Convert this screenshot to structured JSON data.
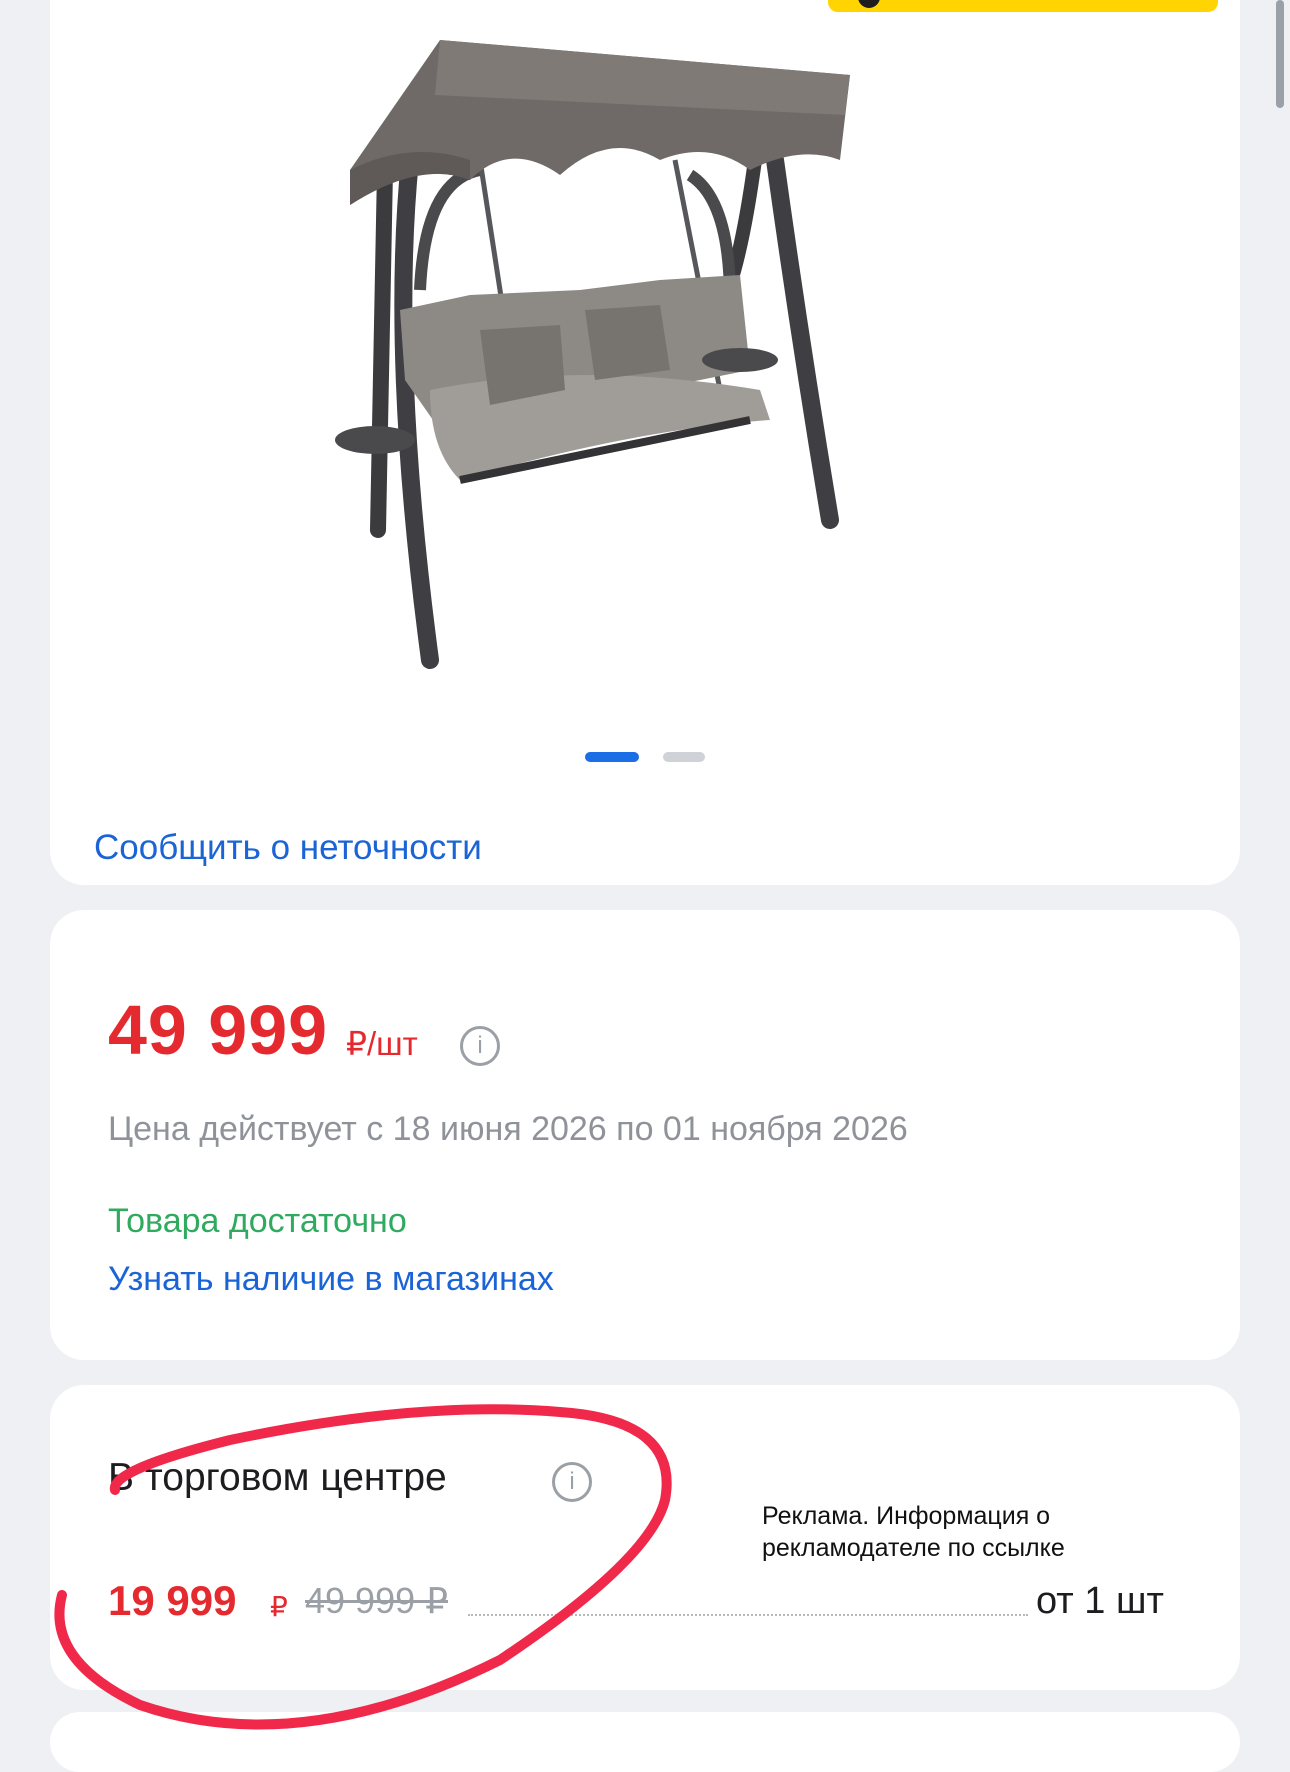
{
  "gallery": {
    "report_link": "Сообщить о неточности",
    "slides_total": 2,
    "slide_active": 1
  },
  "price_card": {
    "price": "49 999",
    "unit": "₽/шт",
    "validity": "Цена действует с 18 июня 2026 по 01 ноября 2026",
    "stock_status": "Товара достаточно",
    "stores_link": "Узнать наличие в магазинах"
  },
  "mall_card": {
    "title": "В торговом центре",
    "price_new": "19 999",
    "currency": "₽",
    "price_old": "49 999 ₽",
    "quantity": "от 1 шт"
  },
  "ad_notice": "Реклама. Информация о рекламодателе по ссылке",
  "icons": {
    "info": "info-icon",
    "price_info_glyph": "i"
  },
  "colors": {
    "price_red": "#e52a2f",
    "link_blue": "#1b64d6",
    "stock_green": "#2faa5f",
    "badge_yellow": "#ffd400",
    "annotation_red": "#f0284a"
  }
}
